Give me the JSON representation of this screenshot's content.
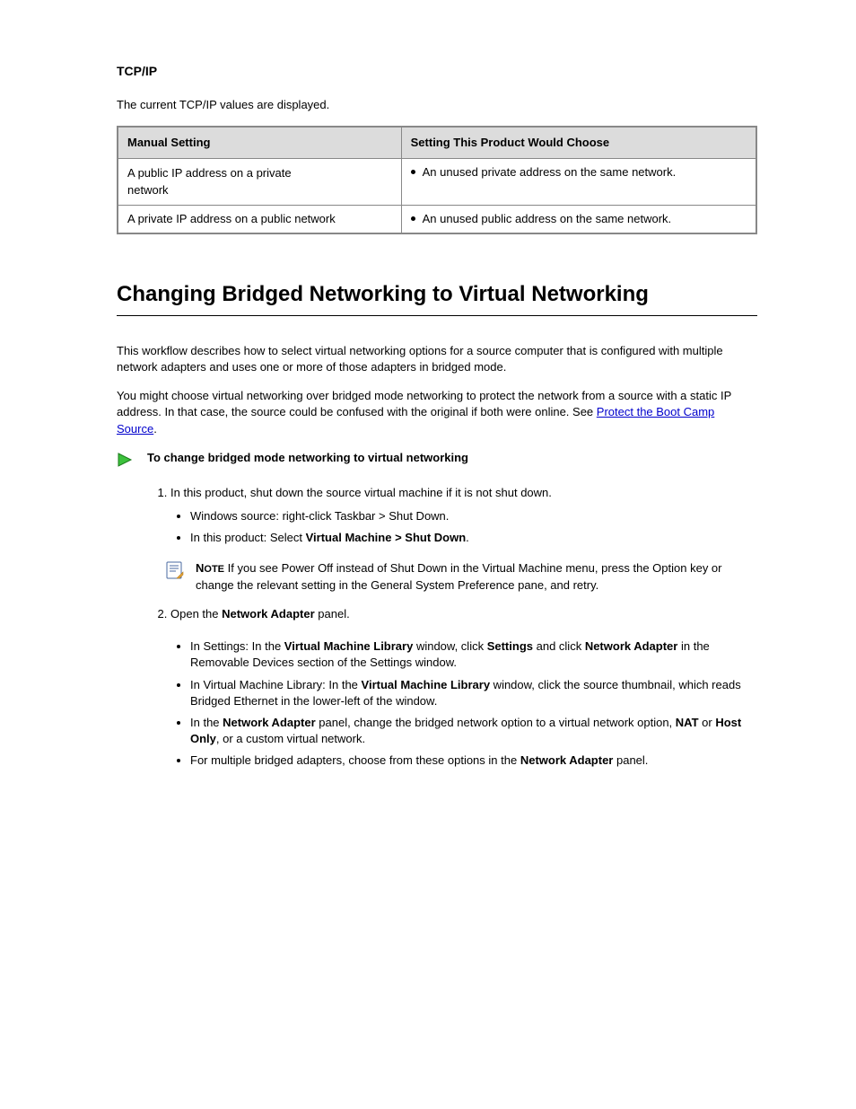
{
  "top": {
    "header": "TCP/IP",
    "lead": "The current TCP/IP values are displayed."
  },
  "table": {
    "thA": "Manual Setting",
    "thB": "Setting This Product Would Choose",
    "r1a_l1": "A public IP address on a private",
    "r1a_l2": "network",
    "r1b": "An unused private address on the same network.",
    "r2a": "A private IP address on a public network",
    "r2b": "An unused public address on the same network."
  },
  "title": "Changing Bridged Networking to Virtual Networking",
  "p1": "This workflow describes how to select virtual networking options for a source computer that is configured with multiple network adapters and uses one or more of those adapters in bridged mode.",
  "p2_pre": "You might choose virtual networking over bridged mode networking to protect the network from a source with a static IP address. In that case, the source could be confused with the original if both were online. See ",
  "p2_link": "Protect the Boot Camp Source",
  "p2_post": ".",
  "arrow_label": "To change bridged mode networking to virtual networking",
  "steps1": {
    "s1": "In this product, shut down the source virtual machine if it is not shut down.",
    "s1b1": "Windows source: right-click Taskbar > Shut Down.",
    "s1b2_pre": "In this product: Select ",
    "s1b2_menu": "Virtual Machine > Shut Down",
    "s1b2_post": "."
  },
  "note": {
    "pre": "N",
    "small": "OTE",
    "post": "   If you see Power Off instead of Shut Down in the Virtual Machine menu, press the Option key or change the relevant setting in the General System Preference pane, and retry."
  },
  "steps2": {
    "intro_pre": "Open the ",
    "intro_bold": "Network Adapter",
    "intro_post": " panel.",
    "b1_pre": "In Settings: In the ",
    "b1_bold": "Virtual Machine Library",
    "b1_mid": " window, click ",
    "b1_bold2": "Settings",
    "b1_mid2": " and click ",
    "b1_bold3": "Network Adapter",
    "b1_post": " in the Removable Devices section of the Settings window.",
    "b2_pre": "In Virtual Machine Library: In the ",
    "b2_bold": "Virtual Machine Library",
    "b2_post": " window, click the source thumbnail, which reads Bridged Ethernet in the lower-left of the window.",
    "b3_pre": "In the ",
    "b3_bold": "Network Adapter",
    "b3_mid": " panel, change the bridged network option to a virtual network option, ",
    "b3_bold2": "NAT",
    "b3_mid2": " or ",
    "b3_bold3": "Host Only",
    "b3_post": ", or a custom virtual network.",
    "b4_pre": "For multiple bridged adapters, choose from these options in the ",
    "b4_bold": "Network Adapter",
    "b4_post": " panel."
  }
}
